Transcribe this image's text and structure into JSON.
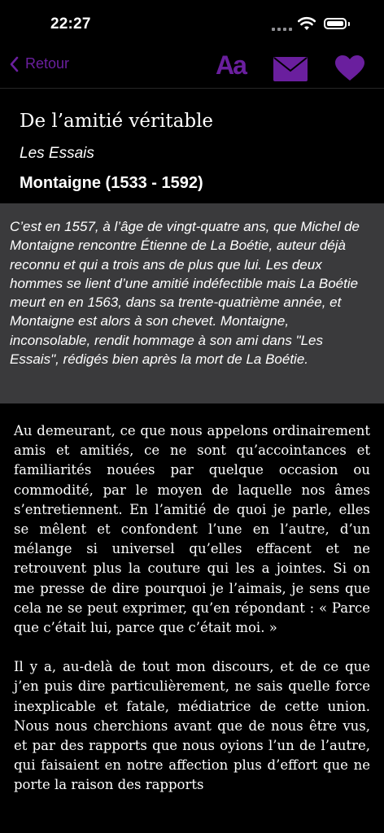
{
  "status_bar": {
    "time": "22:27"
  },
  "nav": {
    "back_label": "Retour",
    "font_label": "Aa",
    "accent_color": "#6a1f9e"
  },
  "header": {
    "title": "De l’amitié véritable",
    "work": "Les Essais",
    "author": "Montaigne (1533 - 1592)"
  },
  "intro": "C’est en 1557, à l’âge de vingt-quatre ans, que Michel de Montaigne rencontre Étienne de La Boétie, auteur déjà reconnu et qui a trois ans de plus que lui. Les deux hommes se lient d’une amitié indéfectible mais La Boétie meurt en en 1563, dans sa trente-quatrième année, et Montaigne est alors à son chevet. Montaigne, inconsolable, rendit hommage à son ami dans \"Les Essais\", rédigés bien après la mort de La Boétie.",
  "text": {
    "p1": "Au demeurant, ce que nous appelons ordinairement amis et amitiés, ce ne sont qu’accointances et familiarités nouées par quelque occasion ou commodité, par le moyen de laquelle nos âmes s’entretiennent. En l’amitié de quoi je parle, elles se mêlent et confondent l’une en l’autre, d’un mélange si universel qu’elles effacent et ne retrouvent plus la couture qui les a jointes. Si on me presse de dire pourquoi je l’aimais, je sens que cela ne se peut exprimer, qu’en répondant : « Parce que c’était lui, parce que c’était moi. »",
    "p2": "Il y a, au-delà de tout mon discours, et de ce que j’en puis dire particulièrement, ne sais quelle force inexplicable et fatale, médiatrice de cette union. Nous nous cherchions avant que de nous être vus, et par des rapports que nous oyions l’un de l’autre, qui faisaient en notre affection plus d’effort que ne porte la raison des rapports"
  }
}
